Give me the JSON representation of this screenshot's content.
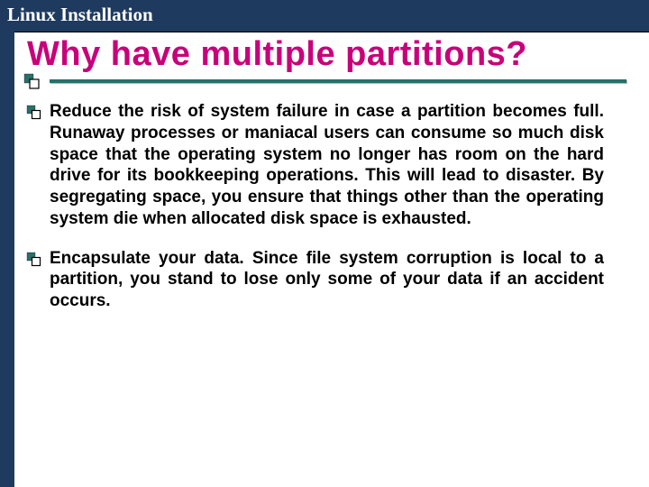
{
  "header": "Linux Installation",
  "title": "Why have multiple partitions?",
  "bullets": [
    "Reduce the risk of system failure in case a partition becomes full. Runaway processes or maniacal users can consume so much disk space that the operating system no longer has room on the hard drive for its bookkeeping operations. This will lead to disaster. By segregating space, you ensure that things other than the operating system die when allocated disk space is exhausted.",
    "Encapsulate your data. Since file system corruption is local to a partition, you stand to lose only some of your data if an accident occurs."
  ],
  "colors": {
    "accent_blue": "#1f3a5f",
    "title_pink": "#c8007a",
    "rule_teal": "#2a6f6a"
  }
}
